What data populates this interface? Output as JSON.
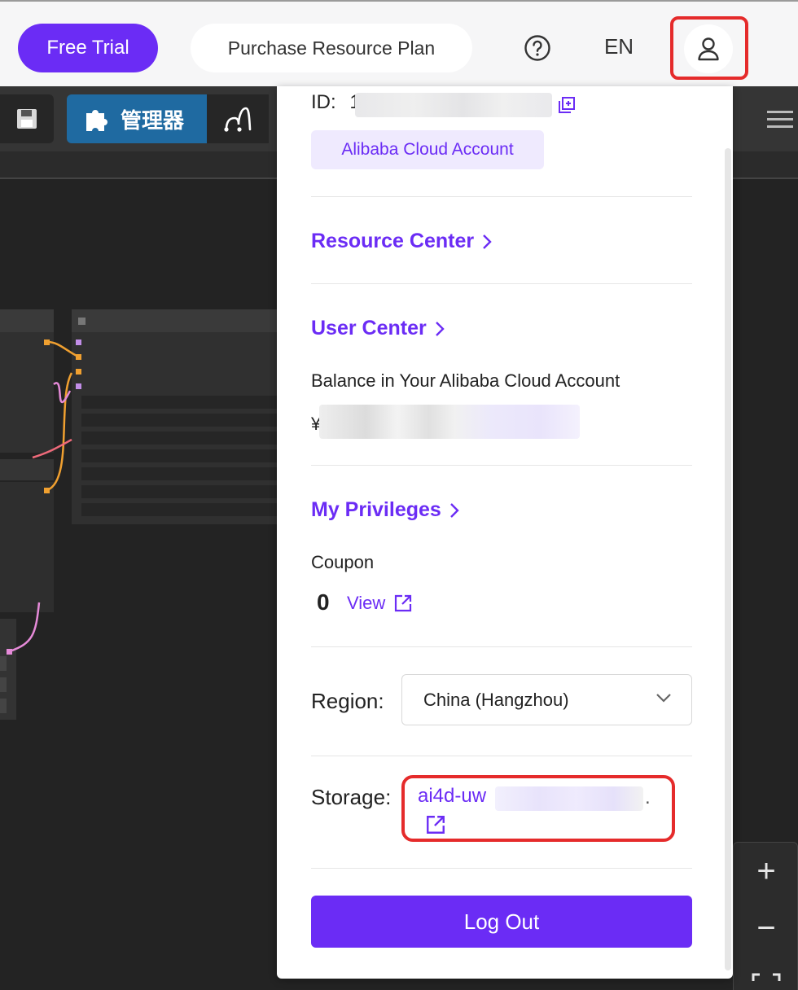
{
  "topbar": {
    "free_trial": "Free Trial",
    "purchase_plan": "Purchase Resource Plan",
    "language": "EN"
  },
  "toolbar": {
    "manager_label": "管理器"
  },
  "zoom": {
    "zoom_in": "+",
    "zoom_out": "−"
  },
  "account_panel": {
    "id_label": "ID:",
    "id_prefix": "1",
    "account_type": "Alibaba Cloud Account",
    "resource_center": "Resource Center",
    "user_center": "User Center",
    "balance_label": "Balance in Your Alibaba Cloud Account",
    "balance_currency": "¥",
    "my_privileges": "My Privileges",
    "coupon_label": "Coupon",
    "coupon_count": "0",
    "coupon_view": "View",
    "region_label": "Region:",
    "region_value": "China (Hangzhou)",
    "storage_label": "Storage:",
    "storage_value": "ai4d-uw",
    "storage_suffix": ".",
    "log_out": "Log Out"
  },
  "colors": {
    "brand_purple": "#6b2cf5",
    "highlight_red": "#e52b2b",
    "manager_blue": "#1f6aa1"
  }
}
